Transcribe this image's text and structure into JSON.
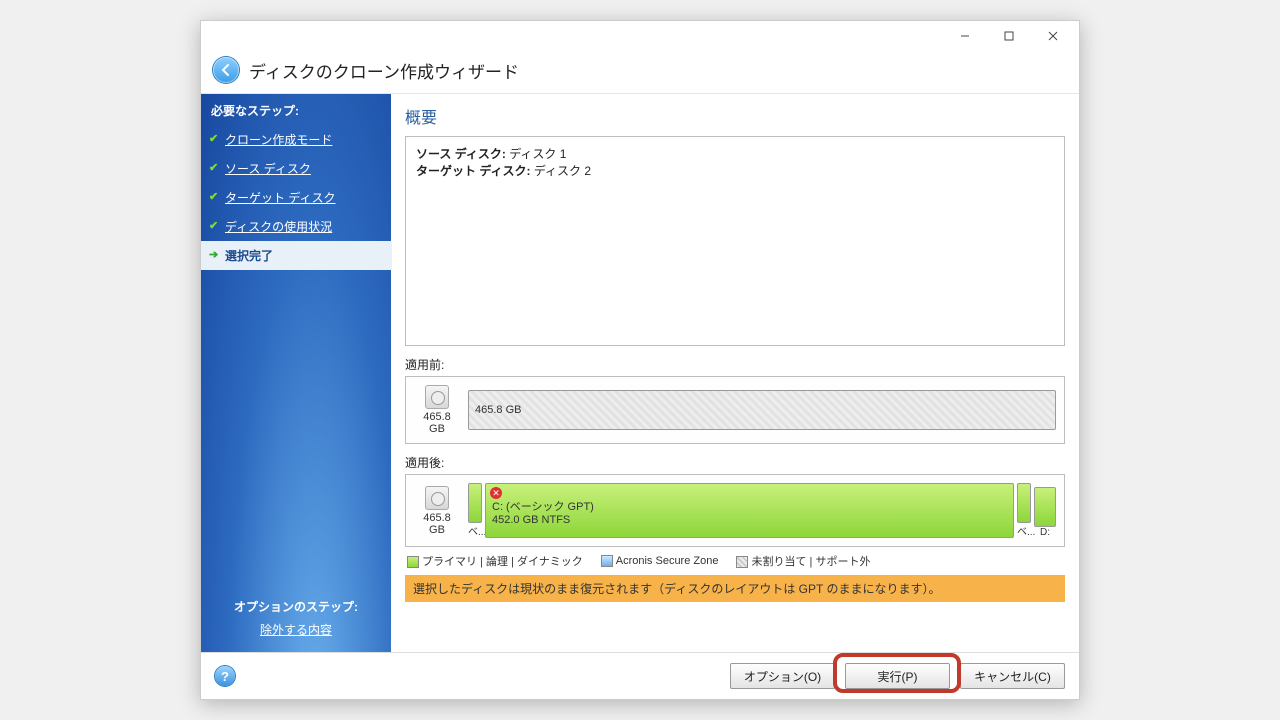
{
  "window": {
    "title": "ディスクのクローン作成ウィザード"
  },
  "sidebar": {
    "steps_title": "必要なステップ:",
    "steps": [
      {
        "label": "クローン作成モード"
      },
      {
        "label": "ソース ディスク"
      },
      {
        "label": "ターゲット ディスク"
      },
      {
        "label": "ディスクの使用状況"
      },
      {
        "label": "選択完了"
      }
    ],
    "optional_title": "オプションのステップ:",
    "optional_link": "除外する内容"
  },
  "main": {
    "section_title": "概要",
    "summary": {
      "source_label": "ソース ディスク:",
      "source_value": "ディスク 1",
      "target_label": "ターゲット ディスク:",
      "target_value": "ディスク 2"
    },
    "before_label": "適用前:",
    "after_label": "適用後:",
    "disk_before": {
      "icon_label": "465.8 GB",
      "part_label": "465.8 GB"
    },
    "disk_after": {
      "icon_label": "465.8 GB",
      "col_labels": {
        "p1": "ベ...",
        "p4": "ベ...",
        "p5": "D:"
      },
      "main_part_name": "C: (ベーシック GPT)",
      "main_part_size": "452.0 GB  NTFS"
    },
    "legend": {
      "primary": "プライマリ",
      "logical": "論理",
      "dynamic": "ダイナミック",
      "secure": "Acronis Secure Zone",
      "unalloc": "未割り当て",
      "unsupported": "サポート外"
    },
    "warning": "選択したディスクは現状のまま復元されます（ディスクのレイアウトは GPT のままになります）。"
  },
  "footer": {
    "options": "オプション(O)",
    "proceed": "実行(P)",
    "cancel": "キャンセル(C)"
  }
}
